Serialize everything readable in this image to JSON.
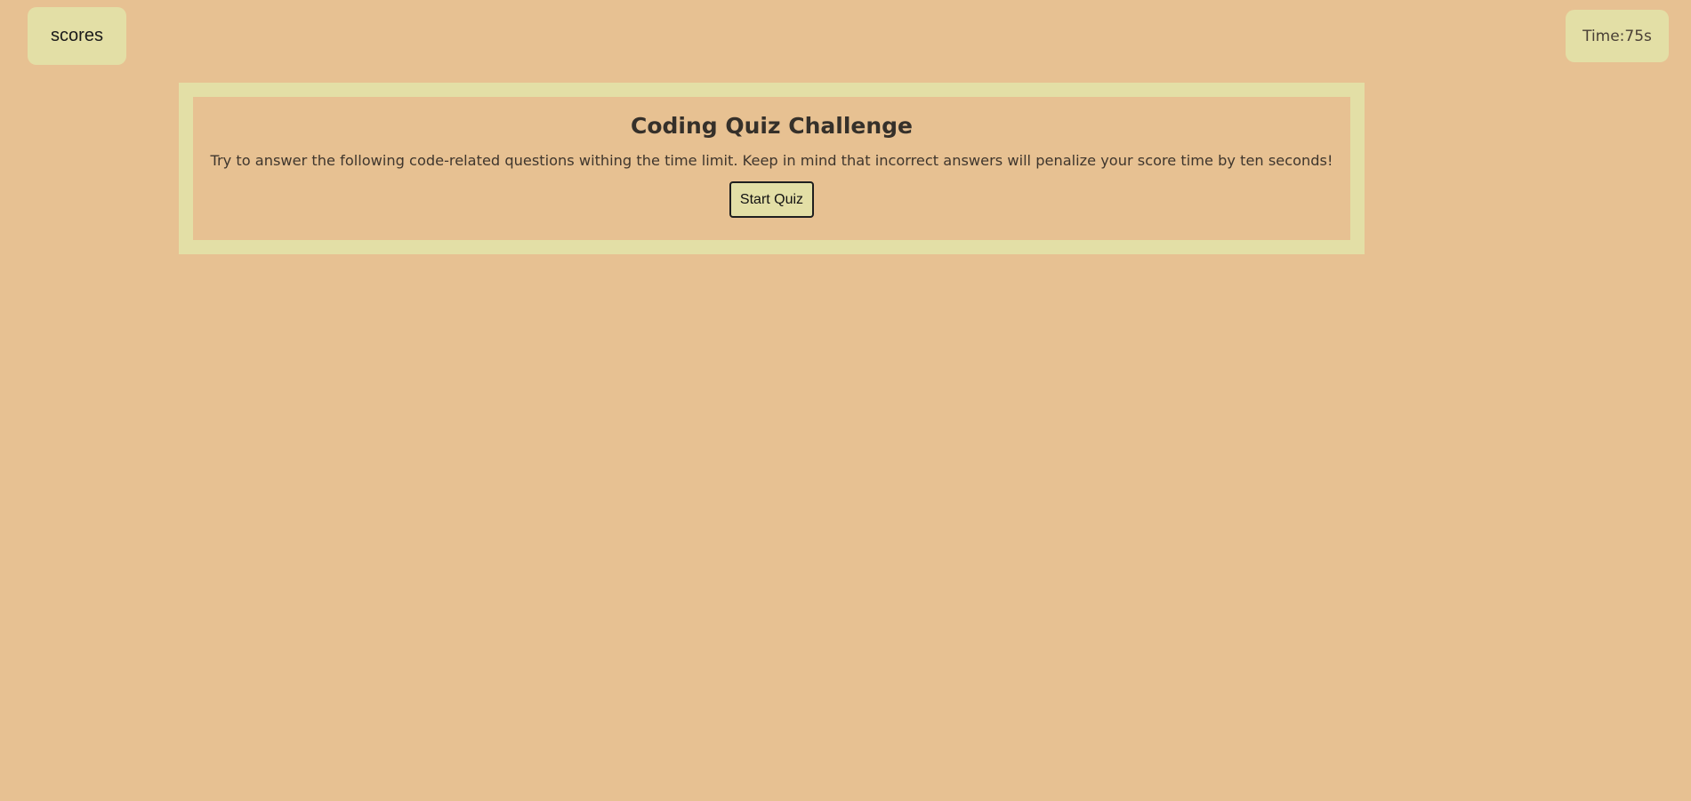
{
  "header": {
    "scores_label": "scores",
    "timer_text": "Time:75s"
  },
  "quiz": {
    "title": "Coding Quiz Challenge",
    "description": "Try to answer the following code-related questions withing the time limit. Keep in mind that incorrect answers will penalize your score time by ten seconds!",
    "start_label": "Start Quiz"
  },
  "colors": {
    "background": "#e7c192",
    "panel": "#e3dfa6",
    "text": "#3a3128"
  }
}
